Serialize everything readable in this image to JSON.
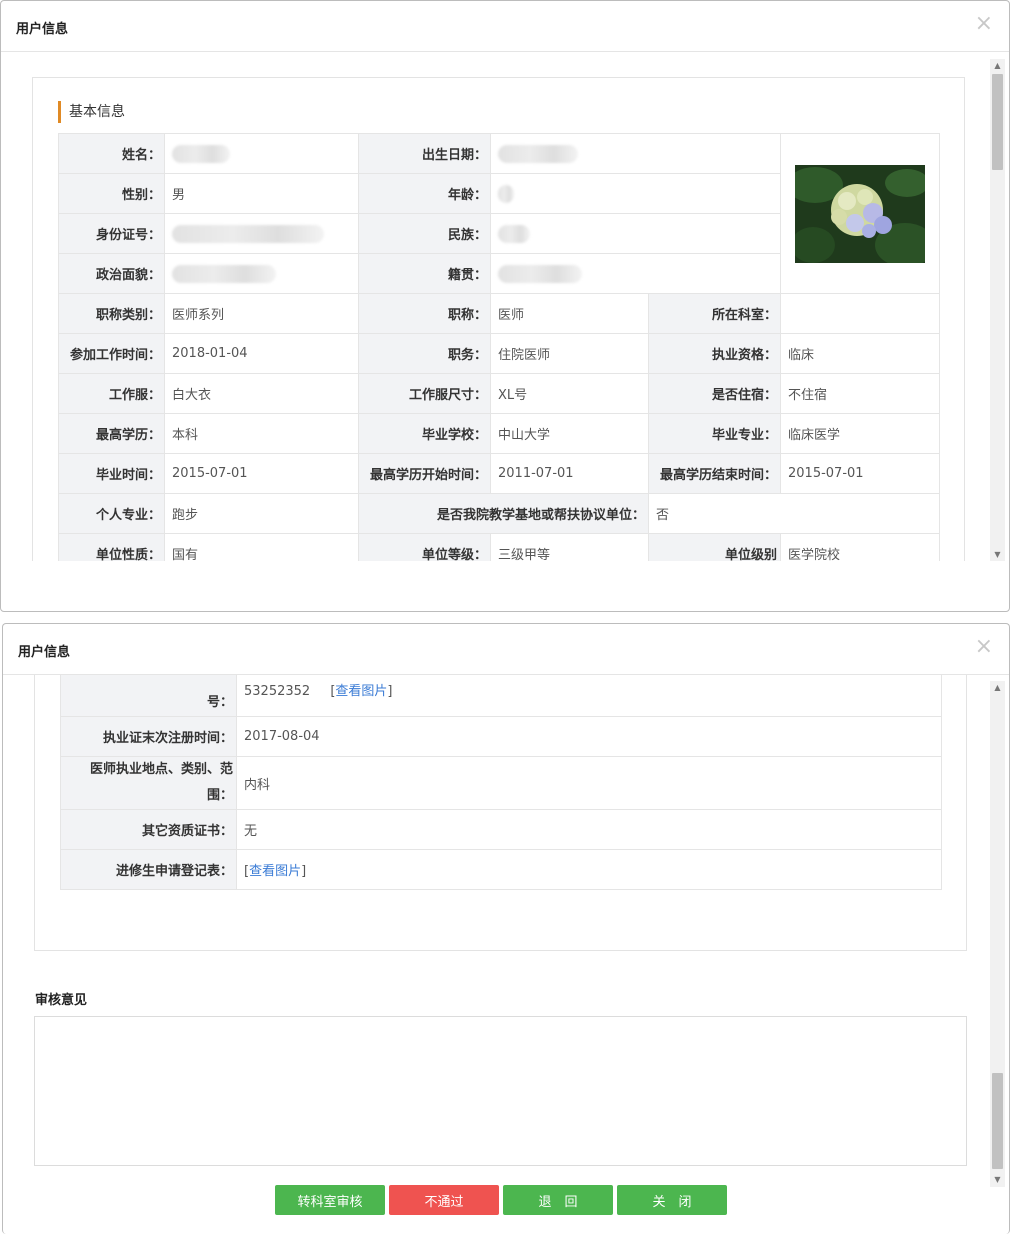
{
  "modal1": {
    "title": "用户信息",
    "close": "×",
    "section_title": "基本信息",
    "labels": {
      "name": "姓名：",
      "birth": "出生日期：",
      "gender": "性别：",
      "age": "年龄：",
      "idcard": "身份证号：",
      "ethnic": "民族：",
      "political": "政治面貌：",
      "native": "籍贯：",
      "title_type": "职称类别：",
      "title": "职称：",
      "dept": "所在科室：",
      "work_start": "参加工作时间：",
      "position": "职务：",
      "qualification": "执业资格：",
      "uniform": "工作服：",
      "uniform_size": "工作服尺寸：",
      "lodging": "是否住宿：",
      "edu": "最高学历：",
      "school": "毕业学校：",
      "major": "毕业专业：",
      "grad_time": "毕业时间：",
      "edu_start": "最高学历开始时间：",
      "edu_end": "最高学历结束时间：",
      "specialty": "个人专业：",
      "base_unit": "是否我院教学基地或帮扶协议单位：",
      "unit_nature": "单位性质：",
      "unit_grade": "单位等级：",
      "unit_level": "单位级别"
    },
    "values": {
      "gender": "男",
      "title_type": "医师系列",
      "title": "医师",
      "dept": "",
      "work_start": "2018-01-04",
      "position": "住院医师",
      "qualification": "临床",
      "uniform": "白大衣",
      "uniform_size": "XL号",
      "lodging": "不住宿",
      "edu": "本科",
      "school": "中山大学",
      "major": "临床医学",
      "grad_time": "2015-07-01",
      "edu_start": "2011-07-01",
      "edu_end": "2015-07-01",
      "specialty": "跑步",
      "base_unit": "否",
      "unit_nature": "国有",
      "unit_grade": "三级甲等",
      "unit_level": "医学院校"
    }
  },
  "modal2": {
    "title": "用户信息",
    "close": "×",
    "rows": [
      {
        "label": "号：",
        "value": "53252352",
        "link": "查看图片"
      },
      {
        "label": "执业证末次注册时间：",
        "value": "2017-08-04"
      },
      {
        "label_line1": "医师执业地点、类别、范",
        "label_line2": "围：",
        "value": "内科"
      },
      {
        "label": "其它资质证书：",
        "value": "无"
      },
      {
        "label": "进修生申请登记表：",
        "link": "查看图片"
      }
    ],
    "audit_title": "审核意见",
    "audit_placeholder": "",
    "buttons": {
      "transfer": "转科室审核",
      "reject": "不通过",
      "back": "退　回",
      "close": "关　闭"
    }
  }
}
